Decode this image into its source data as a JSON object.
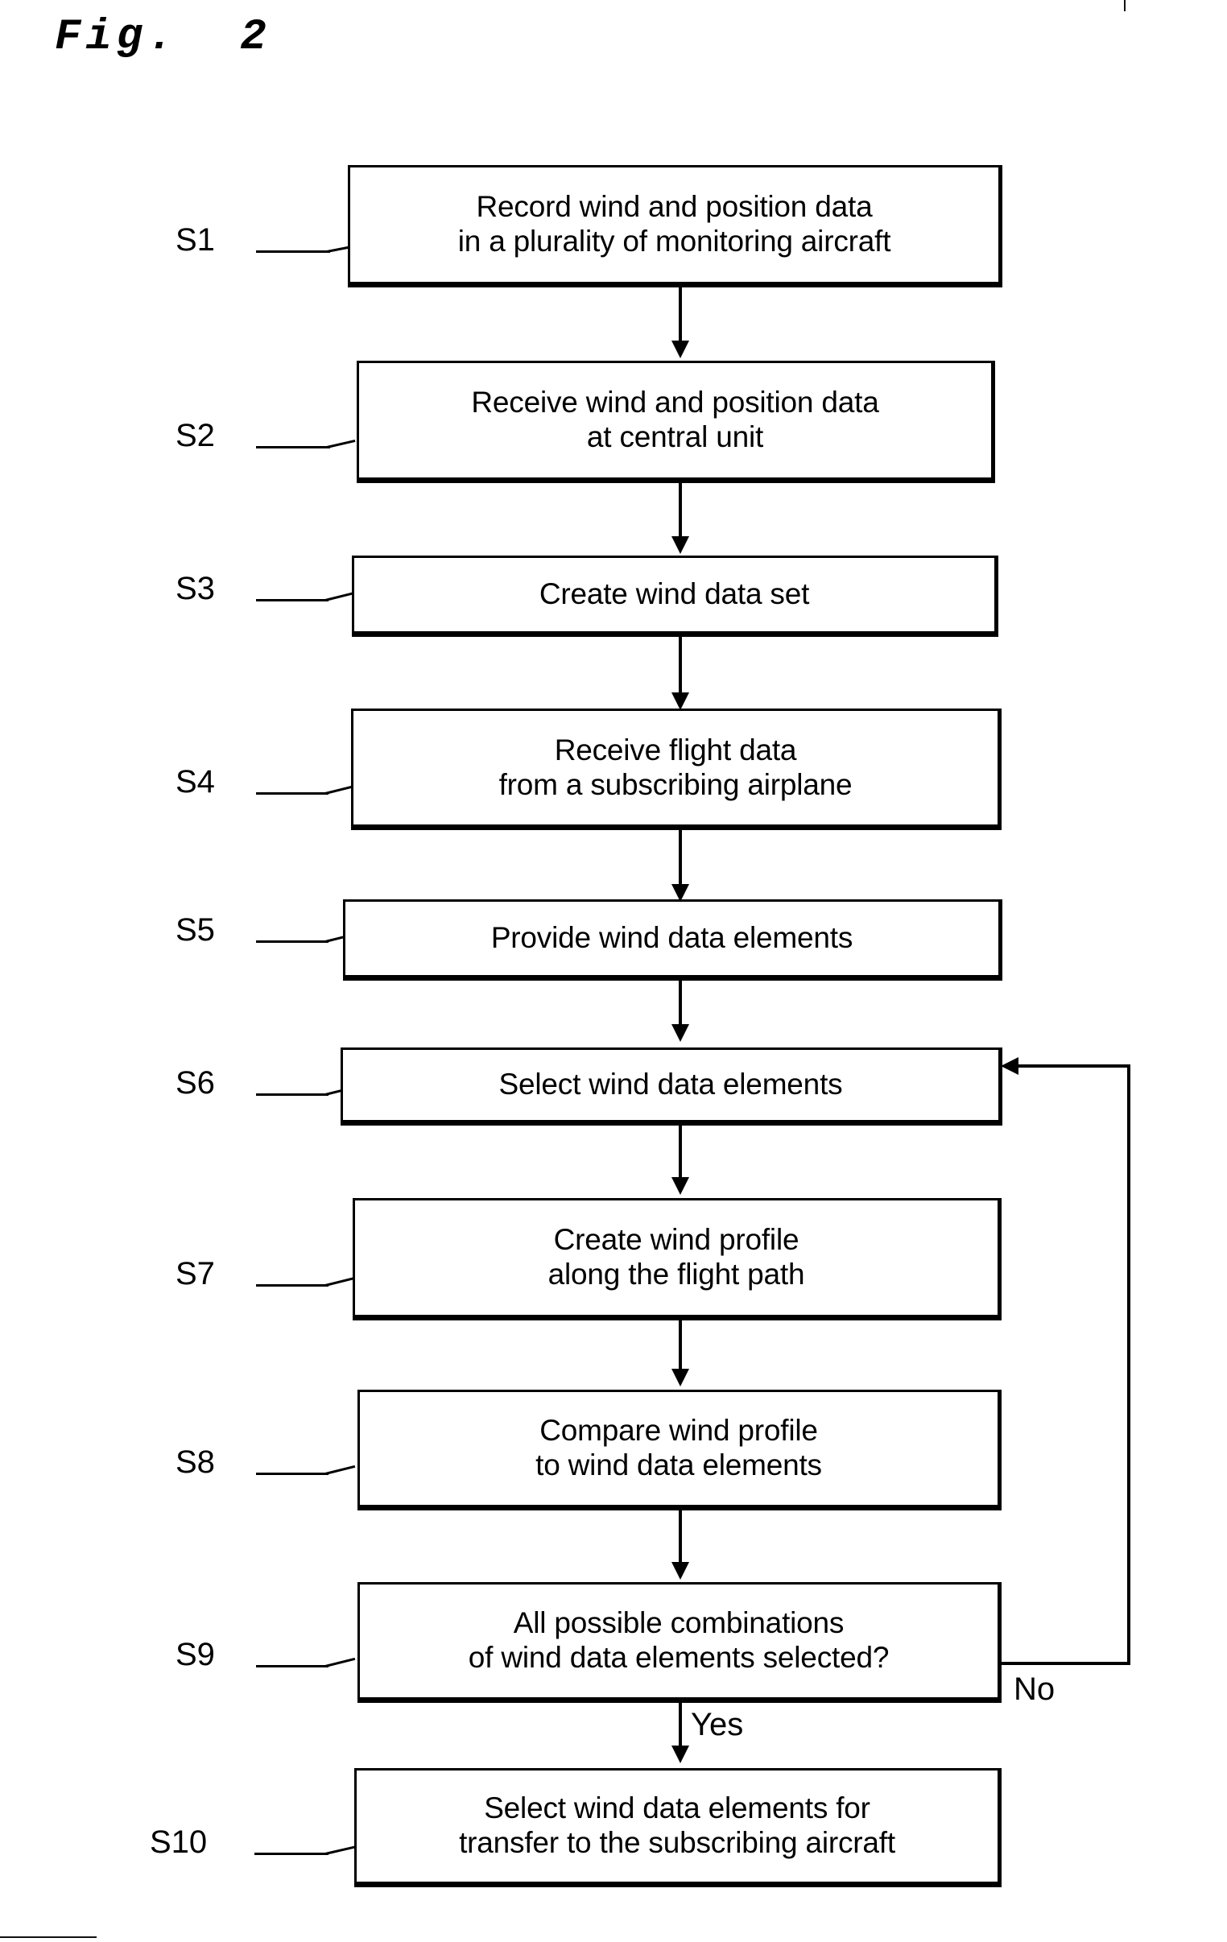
{
  "figure": {
    "title": "Fig.  2",
    "type": "process-flowchart",
    "domain": "aviation wind data distribution"
  },
  "steps": [
    {
      "id": "S1",
      "label": "S1",
      "text": "Record wind and position data\nin a plurality of monitoring aircraft",
      "lines": [
        "Record wind and position data",
        "in a plurality of monitoring aircraft"
      ]
    },
    {
      "id": "S2",
      "label": "S2",
      "text": "Receive wind and position data\nat central unit",
      "lines": [
        "Receive wind and position data",
        "at central unit"
      ]
    },
    {
      "id": "S3",
      "label": "S3",
      "text": "Create wind data set",
      "lines": [
        "Create wind data set"
      ]
    },
    {
      "id": "S4",
      "label": "S4",
      "text": "Receive flight data\nfrom a subscribing airplane",
      "lines": [
        "Receive flight data",
        "from a subscribing airplane"
      ]
    },
    {
      "id": "S5",
      "label": "S5",
      "text": "Provide wind data elements",
      "lines": [
        "Provide wind data elements"
      ]
    },
    {
      "id": "S6",
      "label": "S6",
      "text": "Select wind data elements",
      "lines": [
        "Select wind data elements"
      ]
    },
    {
      "id": "S7",
      "label": "S7",
      "text": "Create wind profile\nalong the flight path",
      "lines": [
        "Create wind profile",
        "along the flight path"
      ]
    },
    {
      "id": "S8",
      "label": "S8",
      "text": "Compare wind profile\nto wind data elements",
      "lines": [
        "Compare wind profile",
        "to wind data elements"
      ]
    },
    {
      "id": "S9",
      "label": "S9",
      "text": "All possible combinations\nof wind data elements selected?",
      "lines": [
        "All possible combinations",
        "of wind data elements selected?"
      ]
    },
    {
      "id": "S10",
      "label": "S10",
      "text": "Select wind data elements for\ntransfer to the subscribing aircraft",
      "lines": [
        "Select wind data elements for",
        "transfer to the subscribing aircraft"
      ]
    }
  ],
  "branches": {
    "no_label": "No",
    "yes_label": "Yes"
  },
  "colors": {
    "ink": "#000000",
    "paper": "#ffffff"
  }
}
